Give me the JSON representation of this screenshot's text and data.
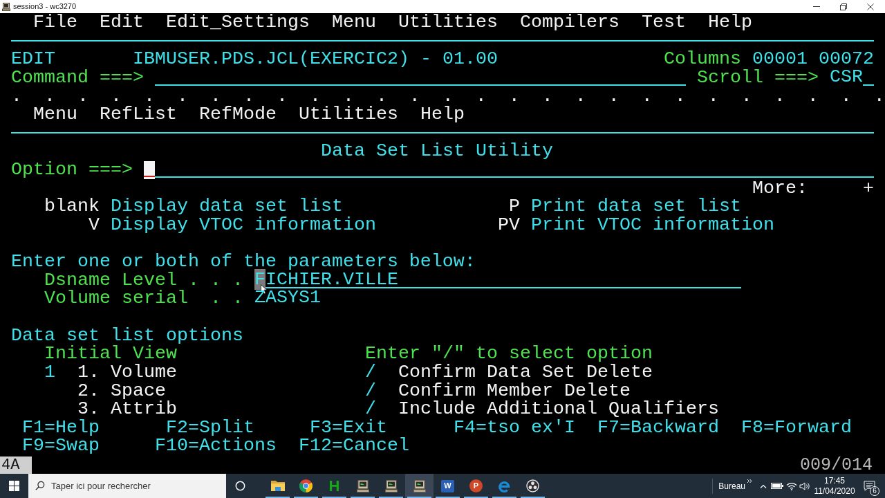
{
  "window": {
    "title": "session3 - wc3270"
  },
  "menu_bar": [
    "File",
    "Edit",
    "Edit_Settings",
    "Menu",
    "Utilities",
    "Compilers",
    "Test",
    "Help"
  ],
  "edit_header": {
    "mode": "EDIT",
    "dataset": "IBMUSER.PDS.JCL(EXERCIC2) - 01.00",
    "columns_label": "Columns",
    "first_column": "00001",
    "last_column": "00072"
  },
  "command_line": {
    "label": "Command ===>",
    "scroll_label": "Scroll ===>",
    "scroll_value": "CSR"
  },
  "split_line": ".  .  .  .  .  .  .  .  .  .  .  .  .  .  .  .  .  .  .  .  .  .  .  .  .  .  .",
  "action_bar": [
    "Menu",
    "RefList",
    "RefMode",
    "Utilities",
    "Help"
  ],
  "panel": {
    "title": "Data Set List Utility",
    "option_label": "Option ===>",
    "option_cursor": true,
    "more_label": "More:",
    "more_sign": "+"
  },
  "option_rows": [
    {
      "left": {
        "key": "blank",
        "description": "Display data set list"
      },
      "right": {
        "key": "P",
        "description": "Print data set list"
      }
    },
    {
      "left": {
        "key": "V",
        "description": "Display VTOC information"
      },
      "right": {
        "key": "PV",
        "description": "Print VTOC information"
      }
    }
  ],
  "parameters": {
    "heading": "Enter one or both of the parameters below:",
    "fields": [
      {
        "label": "Dsname Level . . .",
        "value": "FICHIER.VILLE",
        "underlined": true,
        "hovered": true
      },
      {
        "label": "Volume serial  . .",
        "value": "ZASYS1",
        "underlined": false,
        "hovered": false
      }
    ]
  },
  "list_options": {
    "heading": "Data set list options",
    "initial_view": {
      "label": "Initial View",
      "value": "1",
      "choices": [
        "1. Volume",
        "2. Space",
        "3. Attrib"
      ]
    },
    "select": {
      "label": "Enter \"/\" to select option",
      "items": [
        {
          "value": "/",
          "label": "Confirm Data Set Delete"
        },
        {
          "value": "/",
          "label": "Confirm Member Delete"
        },
        {
          "value": "/",
          "label": "Include Additional Qualifiers"
        }
      ]
    }
  },
  "function_keys": [
    [
      "F1=Help",
      "F2=Split",
      "F3=Exit",
      "F4=tso ex'I",
      "F7=Backward",
      "F8=Forward"
    ],
    [
      "F9=Swap",
      "F10=Actions",
      "F12=Cancel"
    ]
  ],
  "status_line": {
    "indicator": "4A",
    "position": "009/014"
  },
  "taskbar": {
    "search_placeholder": "Taper ici pour rechercher",
    "apps": [
      {
        "kind": "folder",
        "running": true,
        "selected": false
      },
      {
        "kind": "browser",
        "running": true,
        "selected": false
      },
      {
        "kind": "letter",
        "glyph": "H",
        "running": true,
        "selected": false
      },
      {
        "kind": "terminal",
        "running": true,
        "selected": false
      },
      {
        "kind": "terminal",
        "running": true,
        "selected": false
      },
      {
        "kind": "terminal",
        "running": true,
        "selected": true
      },
      {
        "kind": "tile",
        "glyph": "W",
        "running": true,
        "selected": false
      },
      {
        "kind": "disc",
        "glyph": "P",
        "running": true,
        "selected": false
      },
      {
        "kind": "swirl",
        "running": true,
        "selected": false
      },
      {
        "kind": "ring",
        "running": true,
        "selected": false
      }
    ],
    "tray": {
      "desktop_label": "Bureau",
      "time": "17:45",
      "date": "11/04/2020",
      "notification_count": "6"
    }
  }
}
